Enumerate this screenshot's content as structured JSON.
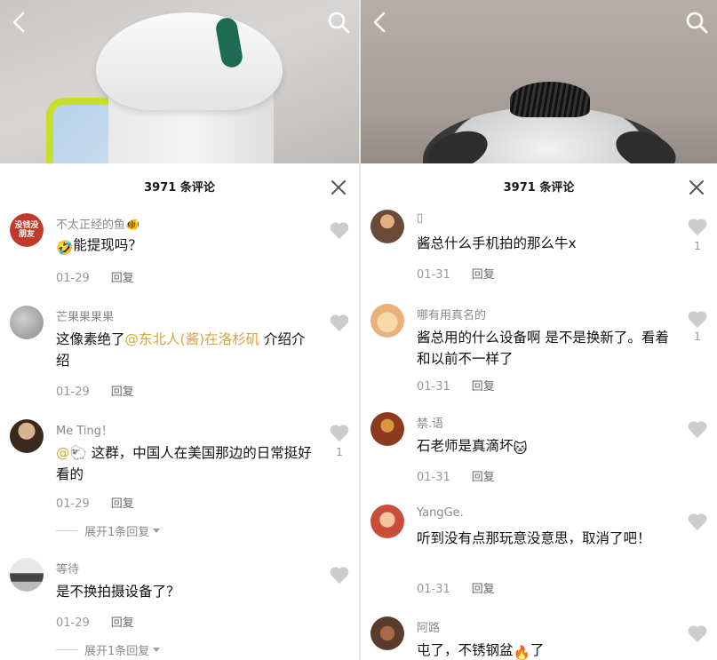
{
  "left_panel": {
    "title": "3971 条评论",
    "comments": [
      {
        "username": "不太正经的鱼",
        "username_emoji": "🐠",
        "text": "能提现吗？",
        "text_prefix_emoji": "🤣",
        "date": "01-29",
        "reply_label": "回复",
        "likes": "",
        "avatar_text": "没钱没朋友",
        "avatar_color": "#c0392b"
      },
      {
        "username": "芒果果果果",
        "text_before": "这像素绝了",
        "mention": "@东北人(酱)在洛杉矶",
        "text_after": " 介绍介绍",
        "date": "01-29",
        "reply_label": "回复",
        "likes": "",
        "avatar_color": "#9a9a9a"
      },
      {
        "username": "Me Ting！",
        "mention": "@🐑",
        "text": " 这群，中国人在美国那边的日常挺好看的",
        "date": "01-29",
        "reply_label": "回复",
        "likes": "1",
        "expand_label": "展开1条回复",
        "avatar_color": "#4a3a2a"
      },
      {
        "username": "等待",
        "text": "是不换拍摄设备了？",
        "date": "01-29",
        "reply_label": "回复",
        "likes": "",
        "expand_label": "展开1条回复",
        "avatar_color": "#6c6c6c"
      }
    ]
  },
  "right_panel": {
    "title": "3971 条评论",
    "comments": [
      {
        "username": "▯",
        "text": "酱总什么手机拍的那么牛x",
        "date": "01-31",
        "reply_label": "回复",
        "likes": "1",
        "avatar_color": "#6b4a3a"
      },
      {
        "username": "哪有用真名的",
        "text": "酱总用的什么设备啊 是不是换新了。看着和以前不一样了",
        "date": "01-31",
        "reply_label": "回复",
        "likes": "1",
        "avatar_color": "#e8b27a"
      },
      {
        "username": "禁.语",
        "text": "石老师是真滴坏",
        "text_suffix_emoji": "🐱",
        "date": "01-31",
        "reply_label": "回复",
        "likes": "",
        "avatar_color": "#8b3a1e"
      },
      {
        "username": "YangGe.",
        "text": "听到没有点那玩意没意思，取消了吧！",
        "date": "01-31",
        "reply_label": "回复",
        "likes": "",
        "avatar_color": "#c94d3a"
      },
      {
        "username": "阿路",
        "text": "屯了，不锈钢盆",
        "text_suffix_emoji": "🔥",
        "text_tail": "了",
        "date": "",
        "reply_label": "",
        "likes": "",
        "avatar_color": "#5a3c2c"
      }
    ]
  },
  "icons": {
    "back": "chevron-left-icon",
    "search": "search-icon",
    "close": "close-icon",
    "like": "heart-icon"
  },
  "colors": {
    "mention": "#d9a33a",
    "username": "#8a8a8a",
    "heart": "#cccccc"
  }
}
